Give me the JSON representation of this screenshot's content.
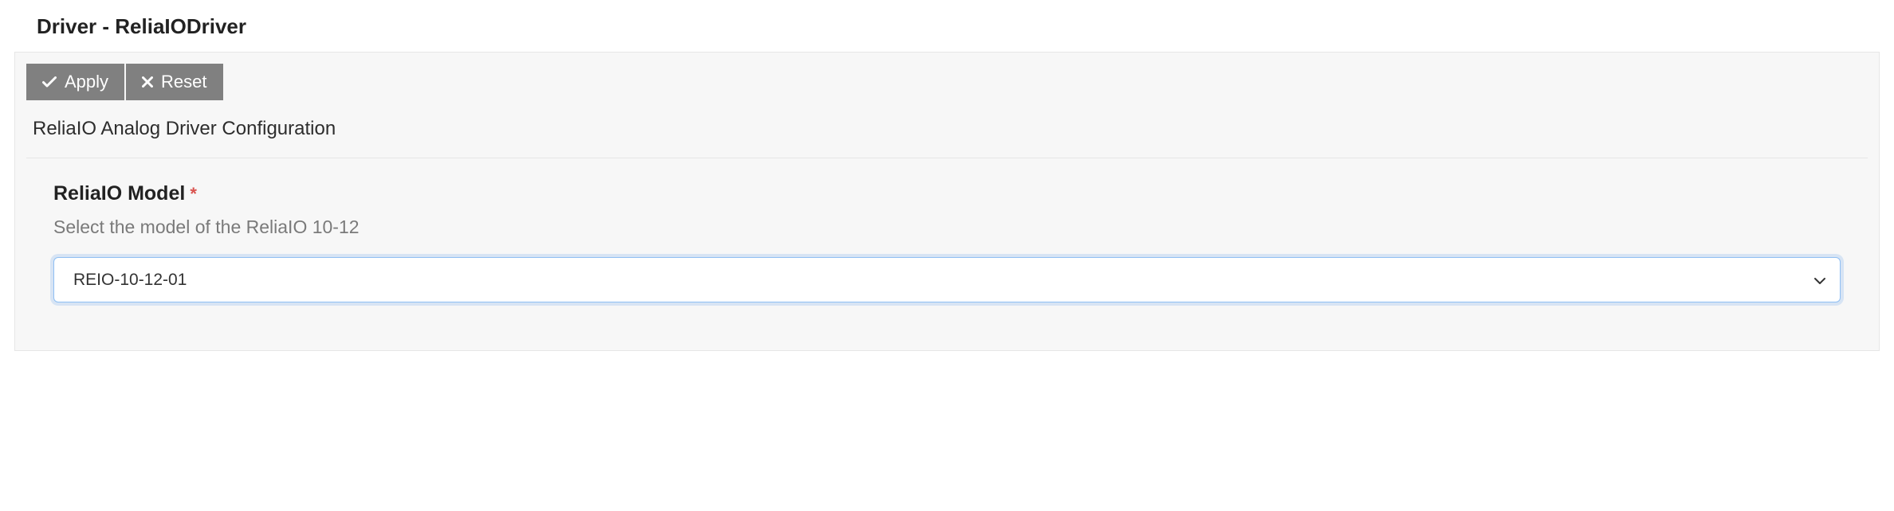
{
  "page": {
    "title": "Driver - ReliaIODriver"
  },
  "toolbar": {
    "apply_label": "Apply",
    "reset_label": "Reset"
  },
  "config": {
    "header": "ReliaIO Analog Driver Configuration"
  },
  "field": {
    "label": "ReliaIO Model",
    "required_mark": "*",
    "help": "Select the model of the ReliaIO 10-12",
    "selected_value": "REIO-10-12-01"
  }
}
